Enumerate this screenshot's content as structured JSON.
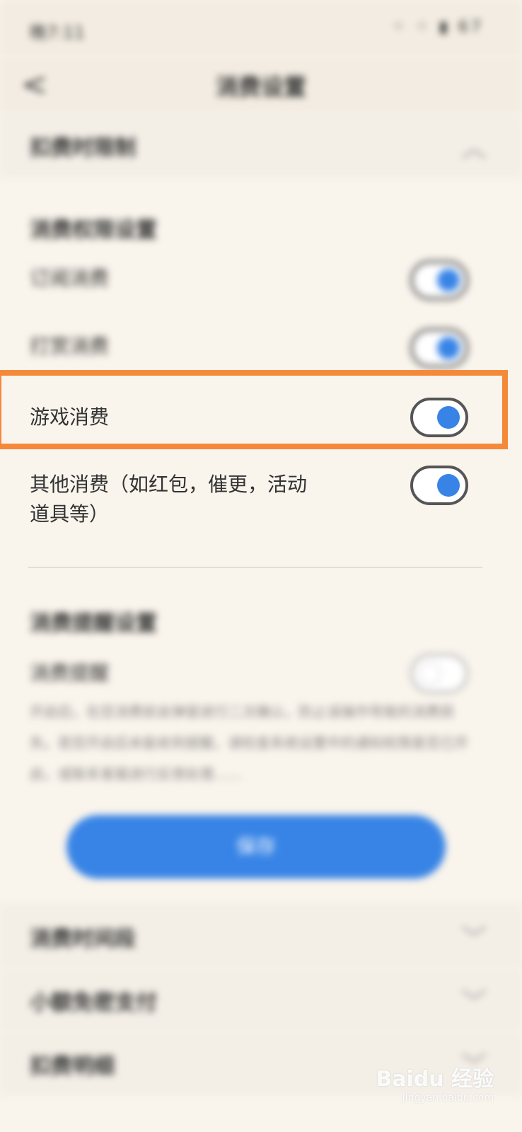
{
  "status_bar": {
    "time": "晚7:11",
    "icons": "⁘ ⁘ ▮ 67"
  },
  "nav": {
    "back": "<",
    "title": "消费设置"
  },
  "sections_top": {
    "label": "扣费时限制"
  },
  "subsection1": {
    "title": "消费权限设置"
  },
  "rows": [
    {
      "label": "订阅消费",
      "on": true
    },
    {
      "label": "打赏消费",
      "on": true
    },
    {
      "label": "游戏消费",
      "on": true
    },
    {
      "label": "其他消费（如红包，催更，活动道具等）",
      "on": true
    }
  ],
  "subsection2": {
    "title": "消费提醒设置"
  },
  "reminder": {
    "label": "消费提醒",
    "on": false,
    "desc": "开启后，在您消费前会弹窗进行二次确认，防止误操作导致的消费损失。若您开启后未能收到提醒，请检查系统设置中的通知权限是否已开启，或联系客服进行反馈处理……"
  },
  "button": {
    "label": "保存"
  },
  "sections_bottom": [
    {
      "label": "消费时间段"
    },
    {
      "label": "小额免密支付"
    },
    {
      "label": "扣费明细"
    }
  ],
  "watermark": {
    "main": "Baidu 经验",
    "sub": "jingyan.baidu.com"
  },
  "colors": {
    "accent": "#3884e6",
    "highlight": "#f5893a",
    "background": "#f9f4ec"
  }
}
